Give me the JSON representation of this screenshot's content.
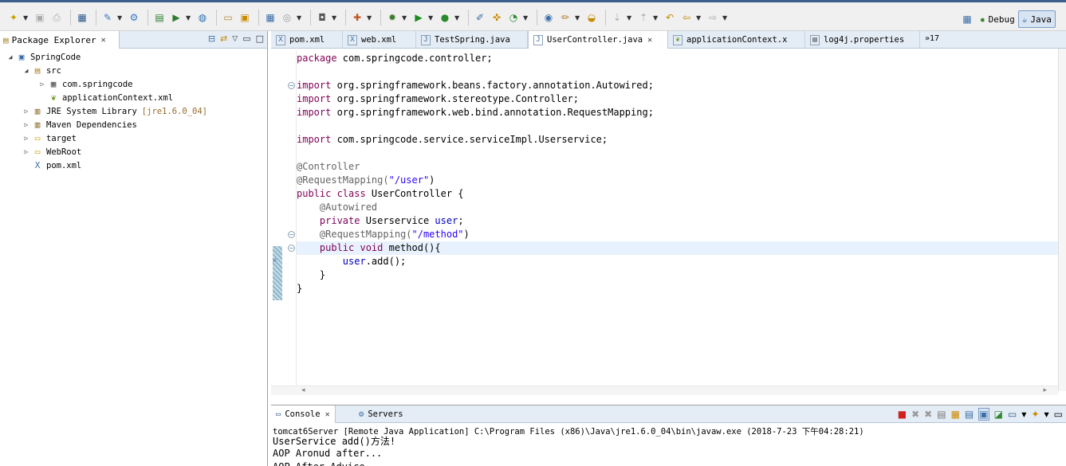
{
  "perspectives": {
    "debug": "Debug",
    "java": "Java"
  },
  "package_explorer": {
    "title": "Package Explorer",
    "tree": [
      {
        "label": "SpringCode",
        "suffix": "",
        "icon": "project-icon",
        "depth": 0,
        "twisty": "expanded"
      },
      {
        "label": "src",
        "suffix": "",
        "icon": "source-folder-icon",
        "depth": 1,
        "twisty": "expanded"
      },
      {
        "label": "com.springcode",
        "suffix": "",
        "icon": "package-icon",
        "depth": 2,
        "twisty": "collapsed"
      },
      {
        "label": "applicationContext.xml",
        "suffix": "",
        "icon": "spring-xml-icon",
        "depth": 2,
        "twisty": "none"
      },
      {
        "label": "JRE System Library",
        "suffix": "[jre1.6.0_04]",
        "icon": "library-icon",
        "depth": 1,
        "twisty": "collapsed"
      },
      {
        "label": "Maven Dependencies",
        "suffix": "",
        "icon": "library-icon",
        "depth": 1,
        "twisty": "collapsed"
      },
      {
        "label": "target",
        "suffix": "",
        "icon": "folder-icon",
        "depth": 1,
        "twisty": "collapsed"
      },
      {
        "label": "WebRoot",
        "suffix": "",
        "icon": "folder-icon",
        "depth": 1,
        "twisty": "collapsed"
      },
      {
        "label": "pom.xml",
        "suffix": "",
        "icon": "xml-file-icon",
        "depth": 1,
        "twisty": "none"
      }
    ]
  },
  "editor": {
    "tabs": [
      {
        "label": "pom.xml",
        "icon": "xml-file-icon",
        "active": false
      },
      {
        "label": "web.xml",
        "icon": "xml-file-icon",
        "active": false
      },
      {
        "label": "TestSpring.java",
        "icon": "java-file-icon",
        "active": false
      },
      {
        "label": "UserController.java",
        "icon": "java-file-icon",
        "active": true
      },
      {
        "label": "applicationContext.x",
        "icon": "spring-xml-icon",
        "active": false
      },
      {
        "label": "log4j.properties",
        "icon": "properties-file-icon",
        "active": false
      }
    ],
    "overflow_count": "»17",
    "code_lines": [
      [
        {
          "t": "package ",
          "c": "kw"
        },
        {
          "t": "com.springcode.controller;",
          "c": "pl"
        }
      ],
      [],
      [
        {
          "t": "import ",
          "c": "kw"
        },
        {
          "t": "org.springframework.beans.factory.annotation.Autowired;",
          "c": "pl"
        }
      ],
      [
        {
          "t": "import ",
          "c": "kw"
        },
        {
          "t": "org.springframework.stereotype.Controller;",
          "c": "pl"
        }
      ],
      [
        {
          "t": "import ",
          "c": "kw"
        },
        {
          "t": "org.springframework.web.bind.annotation.RequestMapping;",
          "c": "pl"
        }
      ],
      [],
      [
        {
          "t": "import ",
          "c": "kw"
        },
        {
          "t": "com.springcode.service.serviceImpl.Userservice;",
          "c": "pl"
        }
      ],
      [],
      [
        {
          "t": "@Controller",
          "c": "ann"
        }
      ],
      [
        {
          "t": "@RequestMapping(",
          "c": "ann"
        },
        {
          "t": "\"/user\"",
          "c": "str"
        },
        {
          "t": ")",
          "c": "pl"
        }
      ],
      [
        {
          "t": "public class ",
          "c": "kw"
        },
        {
          "t": "UserController {",
          "c": "pl"
        }
      ],
      [
        {
          "t": "    @Autowired",
          "c": "ann"
        }
      ],
      [
        {
          "t": "    private ",
          "c": "kw"
        },
        {
          "t": "Userservice ",
          "c": "pl"
        },
        {
          "t": "user",
          "c": "fld"
        },
        {
          "t": ";",
          "c": "pl"
        }
      ],
      [
        {
          "t": "    @RequestMapping(",
          "c": "ann"
        },
        {
          "t": "\"/method\"",
          "c": "str"
        },
        {
          "t": ")",
          "c": "pl"
        }
      ],
      [
        {
          "t": "    public void ",
          "c": "kw"
        },
        {
          "t": "method(){",
          "c": "pl"
        }
      ],
      [
        {
          "t": "        ",
          "c": "pl"
        },
        {
          "t": "user",
          "c": "fld"
        },
        {
          "t": ".add();",
          "c": "pl"
        }
      ],
      [
        {
          "t": "    }",
          "c": "pl"
        }
      ],
      [
        {
          "t": "}",
          "c": "pl"
        }
      ]
    ],
    "current_line_index": 14
  },
  "console": {
    "tabs": [
      {
        "label": "Console",
        "active": true
      },
      {
        "label": "Servers",
        "active": false
      }
    ],
    "launch_info": "tomcat6Server [Remote Java Application] C:\\Program Files (x86)\\Java\\jre1.6.0_04\\bin\\javaw.exe (2018-7-23 下午04:28:21)",
    "output": [
      "UserService add()方法!",
      "AOP Aronud after...",
      "AOP After Advice..."
    ]
  },
  "colors": {
    "keyword": "#7f0055",
    "annotation": "#646464",
    "string": "#2a00ff",
    "field": "#0000c0",
    "current_line": "#e8f2fe",
    "view_header": "#e4ecf5"
  }
}
